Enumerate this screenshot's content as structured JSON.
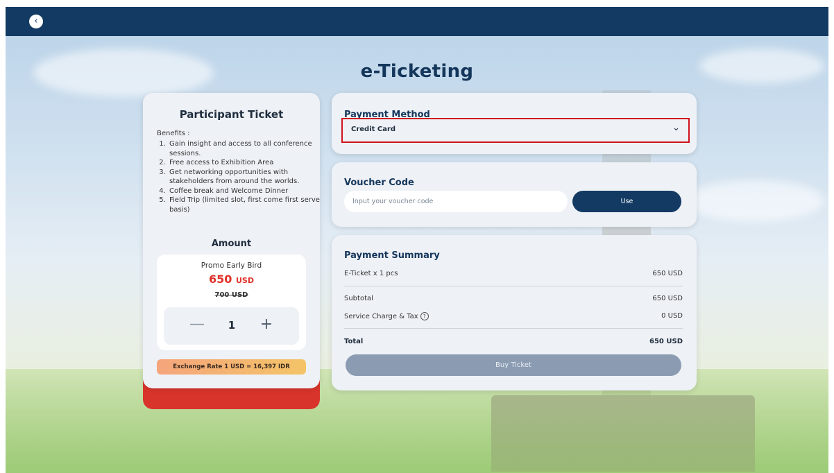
{
  "header": {
    "back_icon": "chevron-left-icon"
  },
  "page": {
    "title": "e-Ticketing"
  },
  "ticket": {
    "title": "Participant Ticket",
    "benefits_label": "Benefits :",
    "benefits": [
      "Gain insight and access to all conference sessions.",
      "Free access to Exhibition Area",
      "Get networking opportunities with stakeholders from around the worlds.",
      "Coffee break and Welcome Dinner",
      "Field Trip (limited slot, first come first serve basis)"
    ],
    "amount_label": "Amount",
    "promo_name": "Promo Early Bird",
    "promo_price": "650",
    "promo_currency": "USD",
    "old_price": "700 USD",
    "quantity": "1",
    "minus_symbol": "—",
    "plus_symbol": "+",
    "exchange_rate": "Exchange Rate 1 USD = 16,397 IDR"
  },
  "payment_method": {
    "title": "Payment Method",
    "selected": "Credit Card",
    "chevron_icon": "chevron-down-icon"
  },
  "voucher": {
    "title": "Voucher Code",
    "placeholder": "Input your voucher code",
    "value": "",
    "button_label": "Use"
  },
  "summary": {
    "title": "Payment Summary",
    "item_label": "E-Ticket x 1 pcs",
    "item_value": "650 USD",
    "subtotal_label": "Subtotal",
    "subtotal_value": "650 USD",
    "service_label": "Service Charge & Tax",
    "service_value": "0 USD",
    "total_label": "Total",
    "total_value": "650 USD",
    "buy_label": "Buy Ticket"
  },
  "colors": {
    "navy": "#123a63",
    "accent_red": "#d9342b",
    "price_red": "#e0312a",
    "selection_outline": "#d0121b"
  }
}
